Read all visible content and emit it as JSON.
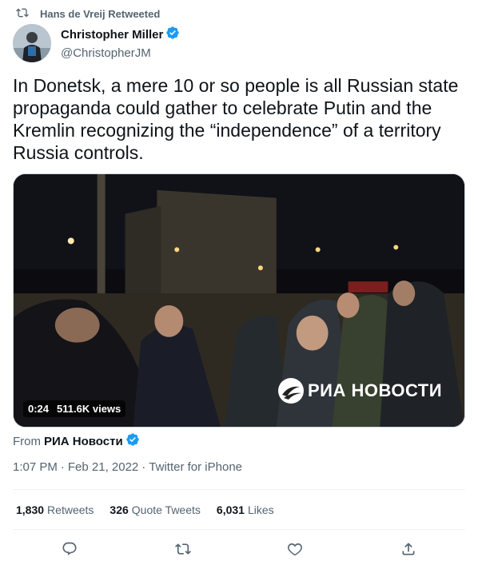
{
  "retweet": {
    "text": "Hans de Vreij Retweeted"
  },
  "author": {
    "name": "Christopher Miller",
    "handle": "@ChristopherJM"
  },
  "tweet": {
    "text": "In Donetsk, a mere 10 or so people is all Russian state propaganda could gather to celebrate Putin and the Kremlin recognizing the “independence” of a territory Russia controls."
  },
  "media": {
    "duration": "0:24",
    "views": "511.6K views",
    "watermark": "РИА НОВОСТИ"
  },
  "source": {
    "prefix": "From",
    "name": "РИА Новости"
  },
  "meta": {
    "time": "1:07 PM",
    "sep": "·",
    "date": "Feb 21, 2022",
    "client": "Twitter for iPhone"
  },
  "stats": {
    "retweets_count": "1,830",
    "retweets_label": "Retweets",
    "quotes_count": "326",
    "quotes_label": "Quote Tweets",
    "likes_count": "6,031",
    "likes_label": "Likes"
  },
  "colors": {
    "verified": "#1d9bf0",
    "secondary_text": "#536471",
    "primary_text": "#0f1419"
  },
  "icons": [
    "retweet-icon",
    "verified-icon",
    "reply-icon",
    "like-icon",
    "share-icon"
  ]
}
